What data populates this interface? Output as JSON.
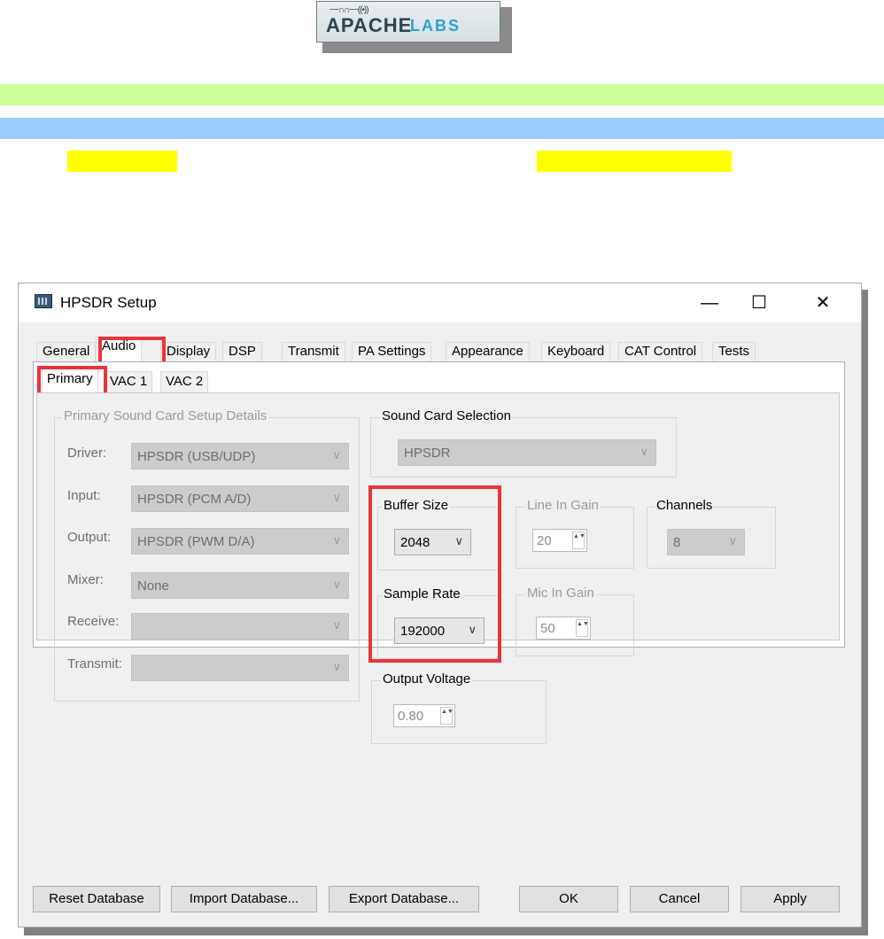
{
  "header": {
    "logo_text_main": "APACHE",
    "logo_text_sub": "LABS",
    "logo_wave": "~~∩∩~~((•))"
  },
  "window": {
    "title": "HPSDR Setup",
    "controls": {
      "minimize": "—",
      "maximize": "☐",
      "close": "✕"
    }
  },
  "tabs": [
    "General",
    "Audio",
    "Display",
    "DSP",
    "Transmit",
    "PA Settings",
    "Appearance",
    "Keyboard",
    "CAT Control",
    "Tests"
  ],
  "subtabs": [
    "Primary",
    "VAC 1",
    "VAC 2"
  ],
  "primary_group": {
    "title": "Primary Sound Card Setup Details",
    "rows": [
      {
        "label": "Driver:",
        "value": "HPSDR (USB/UDP)"
      },
      {
        "label": "Input:",
        "value": "HPSDR (PCM A/D)"
      },
      {
        "label": "Output:",
        "value": "HPSDR (PWM D/A)"
      },
      {
        "label": "Mixer:",
        "value": "None"
      },
      {
        "label": "Receive:",
        "value": ""
      },
      {
        "label": "Transmit:",
        "value": ""
      }
    ]
  },
  "sound_card": {
    "title": "Sound Card Selection",
    "value": "HPSDR"
  },
  "buffer_size": {
    "title": "Buffer Size",
    "value": "2048"
  },
  "sample_rate": {
    "title": "Sample Rate",
    "value": "192000"
  },
  "line_in_gain": {
    "title": "Line In Gain",
    "value": "20"
  },
  "mic_in_gain": {
    "title": "Mic In Gain",
    "value": "50"
  },
  "channels": {
    "title": "Channels",
    "value": "8"
  },
  "output_voltage": {
    "title": "Output Voltage",
    "value": "0.80"
  },
  "icons": {
    "dropdown": "∨",
    "spin": "▲▼"
  },
  "buttons": {
    "reset": "Reset Database",
    "import": "Import Database...",
    "export": "Export Database...",
    "ok": "OK",
    "cancel": "Cancel",
    "apply": "Apply"
  }
}
